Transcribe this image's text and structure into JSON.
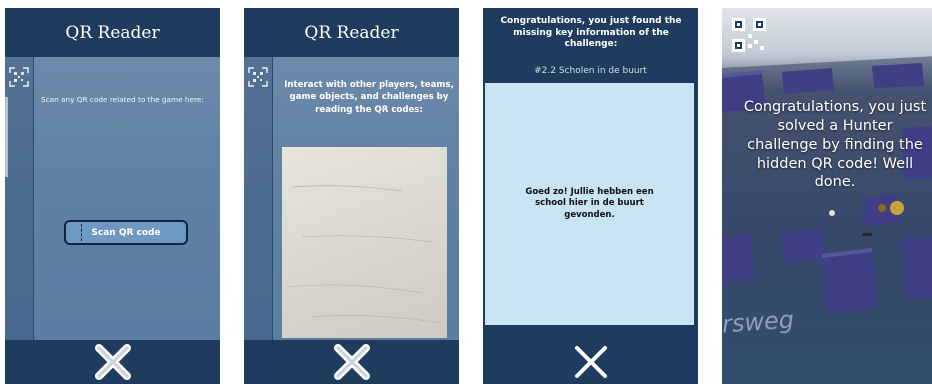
{
  "screen1": {
    "title": "QR Reader",
    "hint": "Scan any QR code related to the game here:",
    "scan_button": "Scan QR code"
  },
  "screen2": {
    "title": "QR Reader",
    "hint": "Interact with other players, teams, game objects, and challenges by reading the QR codes:"
  },
  "screen3": {
    "congrats": "Congratulations, you just found the missing key information of the challenge:",
    "challenge_id": "#2.2 Scholen in de buurt",
    "info": "Goed zo! Jullie hebben een school hier in de buurt gevonden."
  },
  "screen4": {
    "message": "Congratulations, you just solved a Hunter challenge by finding the hidden QR code! Well done.",
    "map_street": "rsweg"
  },
  "icons": {
    "scan": "scan-frame-icon",
    "close": "close-x-icon",
    "qr": "qr-code-icon"
  },
  "colors": {
    "bar": "#1f3c5e",
    "body": "#6785a6",
    "button": "#6f98c3",
    "card": "#c8e3f2"
  }
}
